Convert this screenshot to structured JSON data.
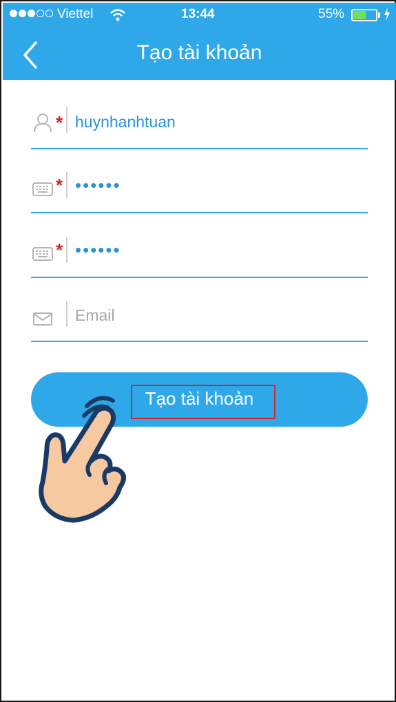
{
  "status_bar": {
    "carrier": "Viettel",
    "time": "13:44",
    "battery_percent_label": "55%",
    "battery_level": 0.55,
    "signal_bars_filled": 3,
    "signal_bars_total": 5
  },
  "header": {
    "title": "Tạo tài khoản",
    "background_color": "#2ea8e8"
  },
  "form": {
    "username": {
      "value": "huynhanhtuan",
      "required": true,
      "icon": "user-icon"
    },
    "password": {
      "value": "••••••",
      "required": true,
      "icon": "keyboard-icon"
    },
    "confirm_password": {
      "value": "••••••",
      "required": true,
      "icon": "keyboard-icon"
    },
    "email": {
      "value": "",
      "placeholder": "Email",
      "required": false,
      "icon": "mail-icon"
    },
    "required_marker": "*"
  },
  "submit_button": {
    "label": "Tạo tài khoản"
  },
  "annotation": {
    "icon": "pointing-hand-icon",
    "highlight_color": "#d6242a"
  }
}
